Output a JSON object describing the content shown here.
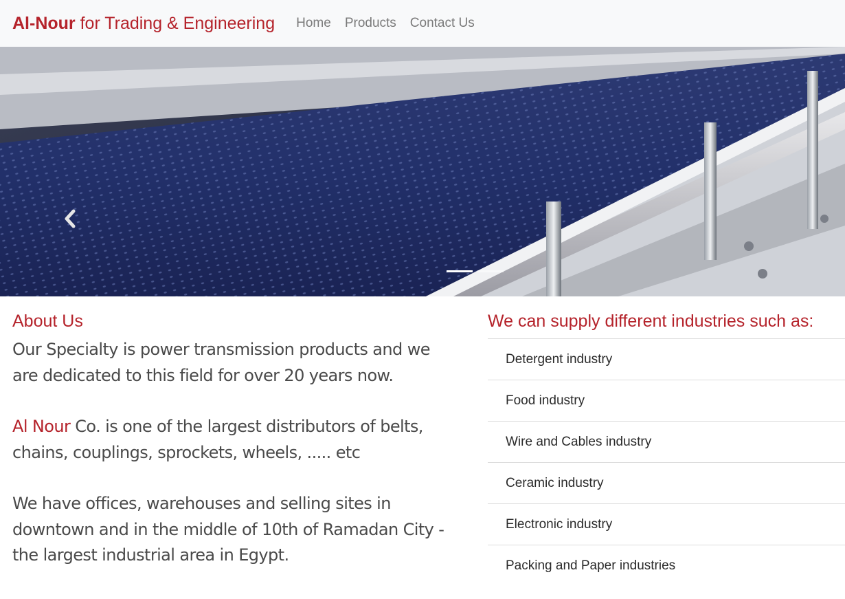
{
  "navbar": {
    "brand_bold": "Al-Nour",
    "brand_rest": "for Trading & Engineering",
    "links": [
      "Home",
      "Products",
      "Contact Us"
    ]
  },
  "carousel": {
    "slide_count": 2,
    "active_index": 0,
    "prev_icon": "chevron-left-icon"
  },
  "about": {
    "title": "About Us",
    "para1": "Our Specialty is power transmission products and we are dedicated to this field for over 20 years now.",
    "para2_highlight": "Al Nour",
    "para2_rest": "Co. is one of the largest distributors of belts, chains, couplings, sprockets, wheels, ..... etc",
    "para3": "We have offices, warehouses and selling sites in downtown and in the middle of 10th of Ramadan City - the largest industrial area in Egypt."
  },
  "industries": {
    "title": "We can supply different industries such as:",
    "items": [
      "Detergent industry",
      "Food industry",
      "Wire and Cables industry",
      "Ceramic industry",
      "Electronic industry",
      "Packing and Paper industries"
    ]
  },
  "colors": {
    "brand_red": "#b5232b",
    "navbar_bg": "#f8f9fa"
  }
}
